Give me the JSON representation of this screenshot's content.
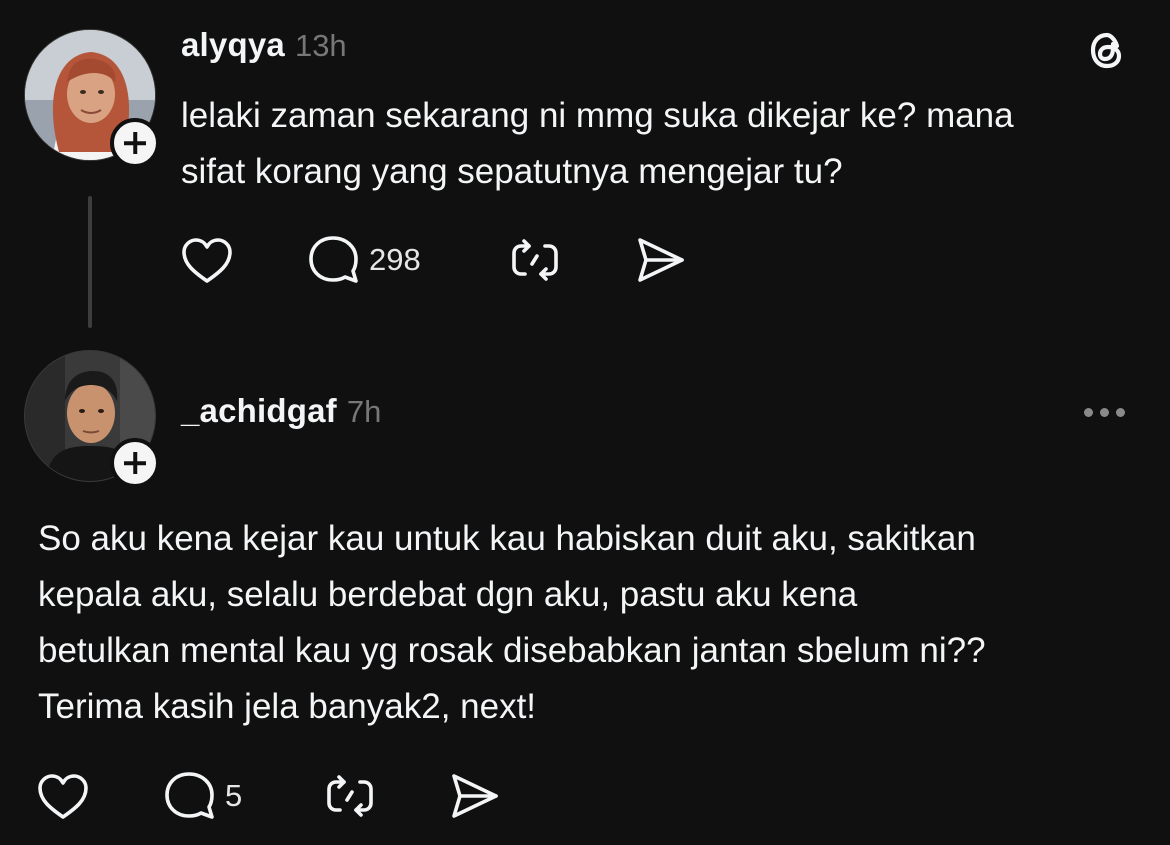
{
  "app": {
    "logo_icon": "threads-logo-icon"
  },
  "posts": [
    {
      "username": "alyqya",
      "time": "13h",
      "text": "lelaki zaman sekarang ni mmg suka dikejar ke? mana\nsifat korang yang sepatutnya mengejar tu?",
      "reply_count": "298",
      "avatar": {
        "hair_color": "#b5563a",
        "bg_color": "#cfd3d8"
      }
    },
    {
      "username": "_achidgaf",
      "time": "7h",
      "text": "So aku kena kejar kau untuk kau habiskan duit aku, sakitkan\nkepala aku, selalu berdebat dgn aku, pastu aku kena\nbetulkan mental kau yg rosak disebabkan jantan sbelum ni??\nTerima kasih jela banyak2, next!",
      "reply_count": "5",
      "avatar": {
        "hair_color": "#1a1a1a",
        "bg_color": "#2e2e2e"
      }
    }
  ],
  "icons": {
    "like": "heart-icon",
    "reply": "comment-icon",
    "repost": "repost-icon",
    "share": "send-icon",
    "follow": "plus-icon",
    "more": "more-options-icon"
  }
}
